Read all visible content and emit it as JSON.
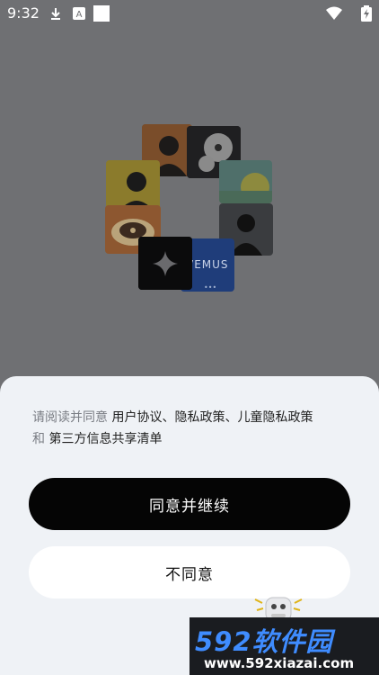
{
  "status_bar": {
    "time": "9:32",
    "left_icons": [
      "download-icon",
      "a-app-icon",
      "square-app-icon"
    ],
    "right_icons": [
      "wifi-icon",
      "battery-icon"
    ]
  },
  "art": {
    "tile_label": "VEMUS"
  },
  "consent": {
    "prefix": "请阅读并同意",
    "links": [
      "用户协议",
      "隐私政策",
      "儿童隐私政策"
    ],
    "separator": "、",
    "conjunction": "和",
    "last_link": "第三方信息共享清单"
  },
  "buttons": {
    "agree_label": "同意并继续",
    "disagree_label": "不同意"
  },
  "watermark": {
    "brand": "592软件园",
    "url": "www.592xiazai.com"
  },
  "colors": {
    "overlay_bg": "#6f7073",
    "sheet_bg": "#eff2f6",
    "primary_btn": "#050505",
    "secondary_btn": "#ffffff",
    "watermark_accent": "#3f8cff"
  }
}
